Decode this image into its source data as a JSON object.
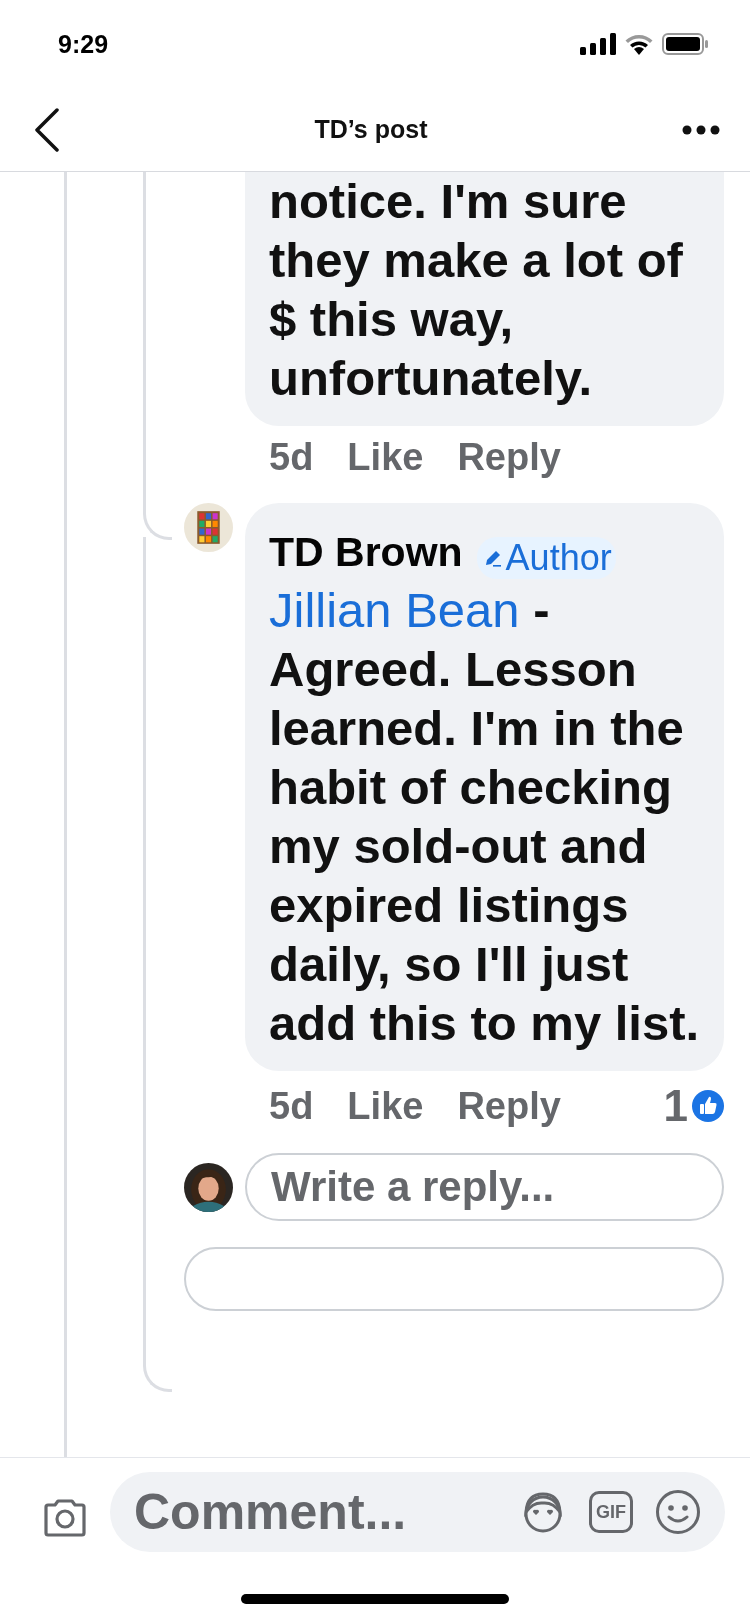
{
  "status_bar": {
    "time": "9:29"
  },
  "header": {
    "title": "TD’s post"
  },
  "comments": [
    {
      "kind": "continued",
      "body": "notice. I'm sure they make a lot of $ this way, unfortunately.",
      "time": "5d",
      "like": "Like",
      "reply": "Reply"
    },
    {
      "kind": "full",
      "author": "TD Brown",
      "badge": "Author",
      "mention": "Jillian Bean",
      "body": " - Agreed. Lesson learned. I'm in the habit of checking my sold-out and expired listings daily, so I'll just add this to my list.",
      "time": "5d",
      "like": "Like",
      "reply": "Reply",
      "reaction_count": "1"
    }
  ],
  "reply_box": {
    "placeholder": "Write a reply..."
  },
  "composer": {
    "placeholder": "Comment...",
    "gif": "GIF"
  }
}
